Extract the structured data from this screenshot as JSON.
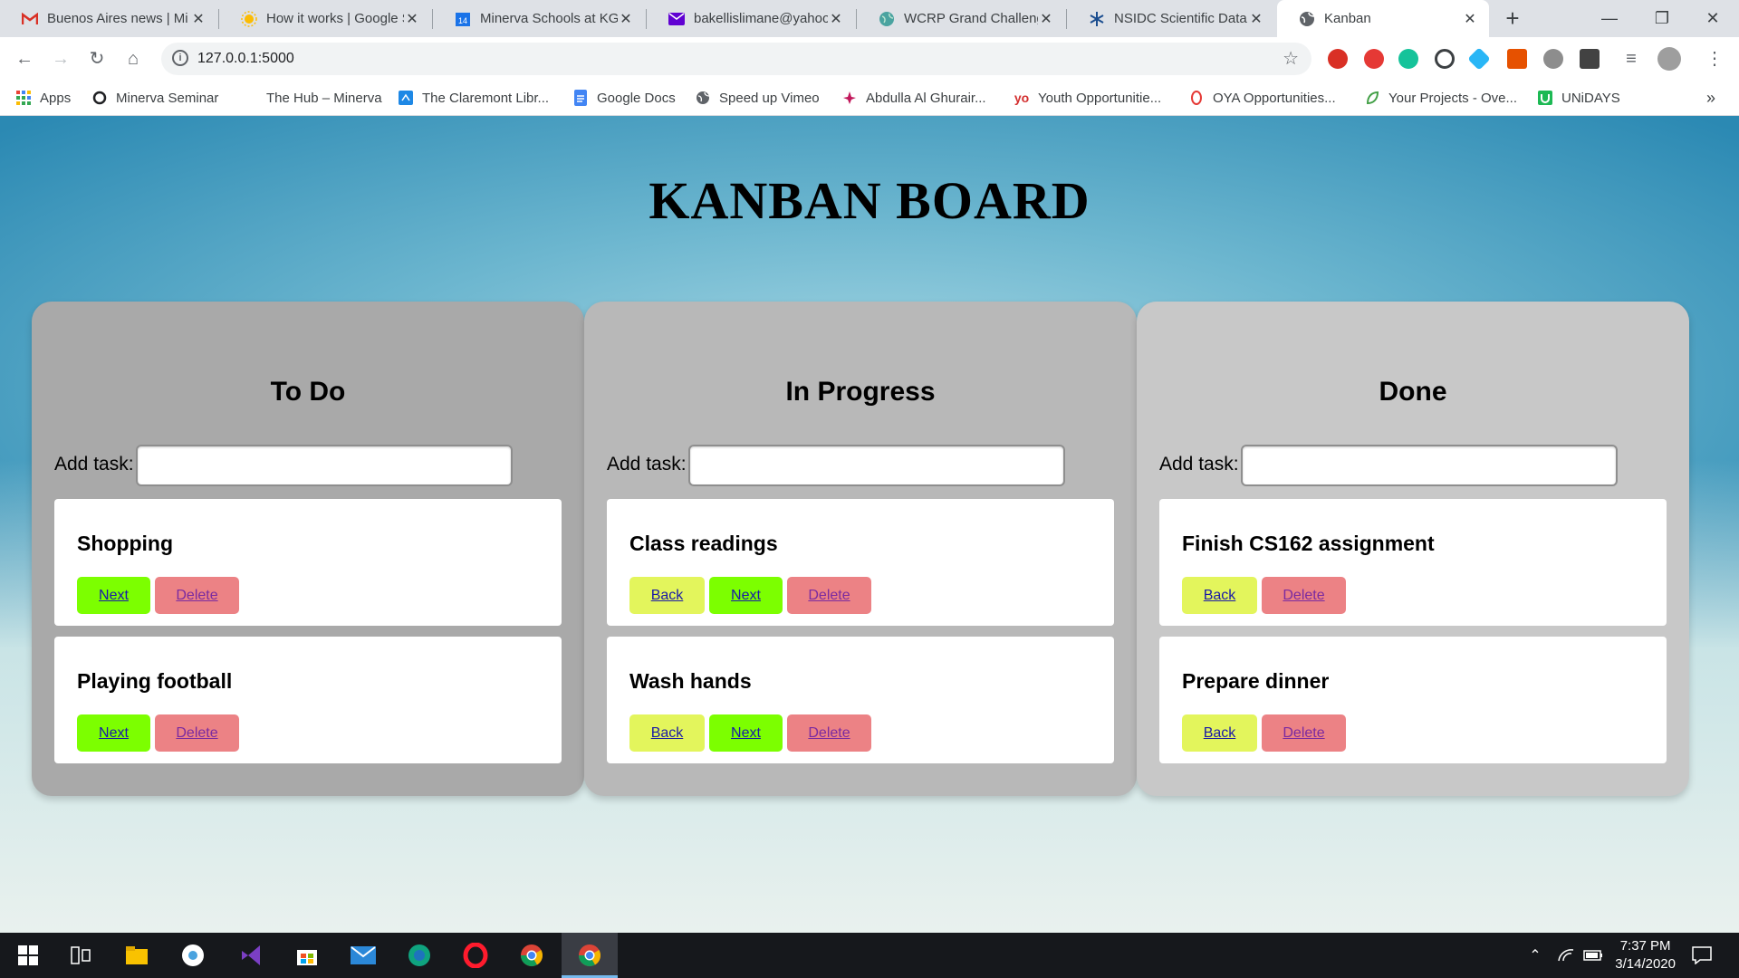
{
  "browser": {
    "tabs": [
      {
        "label": "Buenos Aires news | Mi",
        "icon": "gmail-icon"
      },
      {
        "label": "How it works | Google S",
        "icon": "sun-icon"
      },
      {
        "label": "Minerva Schools at KGI",
        "icon": "calendar-icon"
      },
      {
        "label": "bakellislimane@yahoo.",
        "icon": "mail-icon"
      },
      {
        "label": "WCRP Grand Challenge",
        "icon": "globe-icon"
      },
      {
        "label": "NSIDC Scientific Data S",
        "icon": "snowflake-icon"
      },
      {
        "label": "Kanban",
        "icon": "globe-icon",
        "active": true
      }
    ],
    "url": "127.0.0.1:5000",
    "bookmarks": [
      {
        "label": "Apps",
        "icon": "apps-grid-icon"
      },
      {
        "label": "Minerva Seminar",
        "icon": "ring-icon"
      },
      {
        "label": "The Hub – Minerva",
        "icon": "blank-icon"
      },
      {
        "label": "The Claremont Libr...",
        "icon": "library-icon"
      },
      {
        "label": "Google Docs",
        "icon": "docs-icon"
      },
      {
        "label": "Speed up Vimeo",
        "icon": "globe-icon"
      },
      {
        "label": "Abdulla Al Ghurair...",
        "icon": "flower-icon"
      },
      {
        "label": "Youth Opportunitie...",
        "icon": "yo-icon"
      },
      {
        "label": "OYA Opportunities...",
        "icon": "ring-icon"
      },
      {
        "label": "Your Projects - Ove...",
        "icon": "leaf-icon"
      },
      {
        "label": "UNiDAYS",
        "icon": "unidays-icon"
      }
    ],
    "bookmarks_overflow": "»"
  },
  "board": {
    "title": "KANBAN BOARD",
    "add_label": "Add task:",
    "columns": [
      {
        "name": "To Do",
        "color": "#a9a9a9",
        "tasks": [
          {
            "title": "Shopping",
            "actions": [
              "Next",
              "Delete"
            ]
          },
          {
            "title": "Playing football",
            "actions": [
              "Next",
              "Delete"
            ]
          }
        ]
      },
      {
        "name": "In Progress",
        "color": "#b8b8b8",
        "tasks": [
          {
            "title": "Class readings",
            "actions": [
              "Back",
              "Next",
              "Delete"
            ]
          },
          {
            "title": "Wash hands",
            "actions": [
              "Back",
              "Next",
              "Delete"
            ]
          }
        ]
      },
      {
        "name": "Done",
        "color": "#c8c8c8",
        "tasks": [
          {
            "title": "Finish CS162 assignment",
            "actions": [
              "Back",
              "Delete"
            ]
          },
          {
            "title": "Prepare dinner",
            "actions": [
              "Back",
              "Delete"
            ]
          }
        ]
      }
    ]
  },
  "taskbar": {
    "time": "7:37 PM",
    "date": "3/14/2020"
  }
}
